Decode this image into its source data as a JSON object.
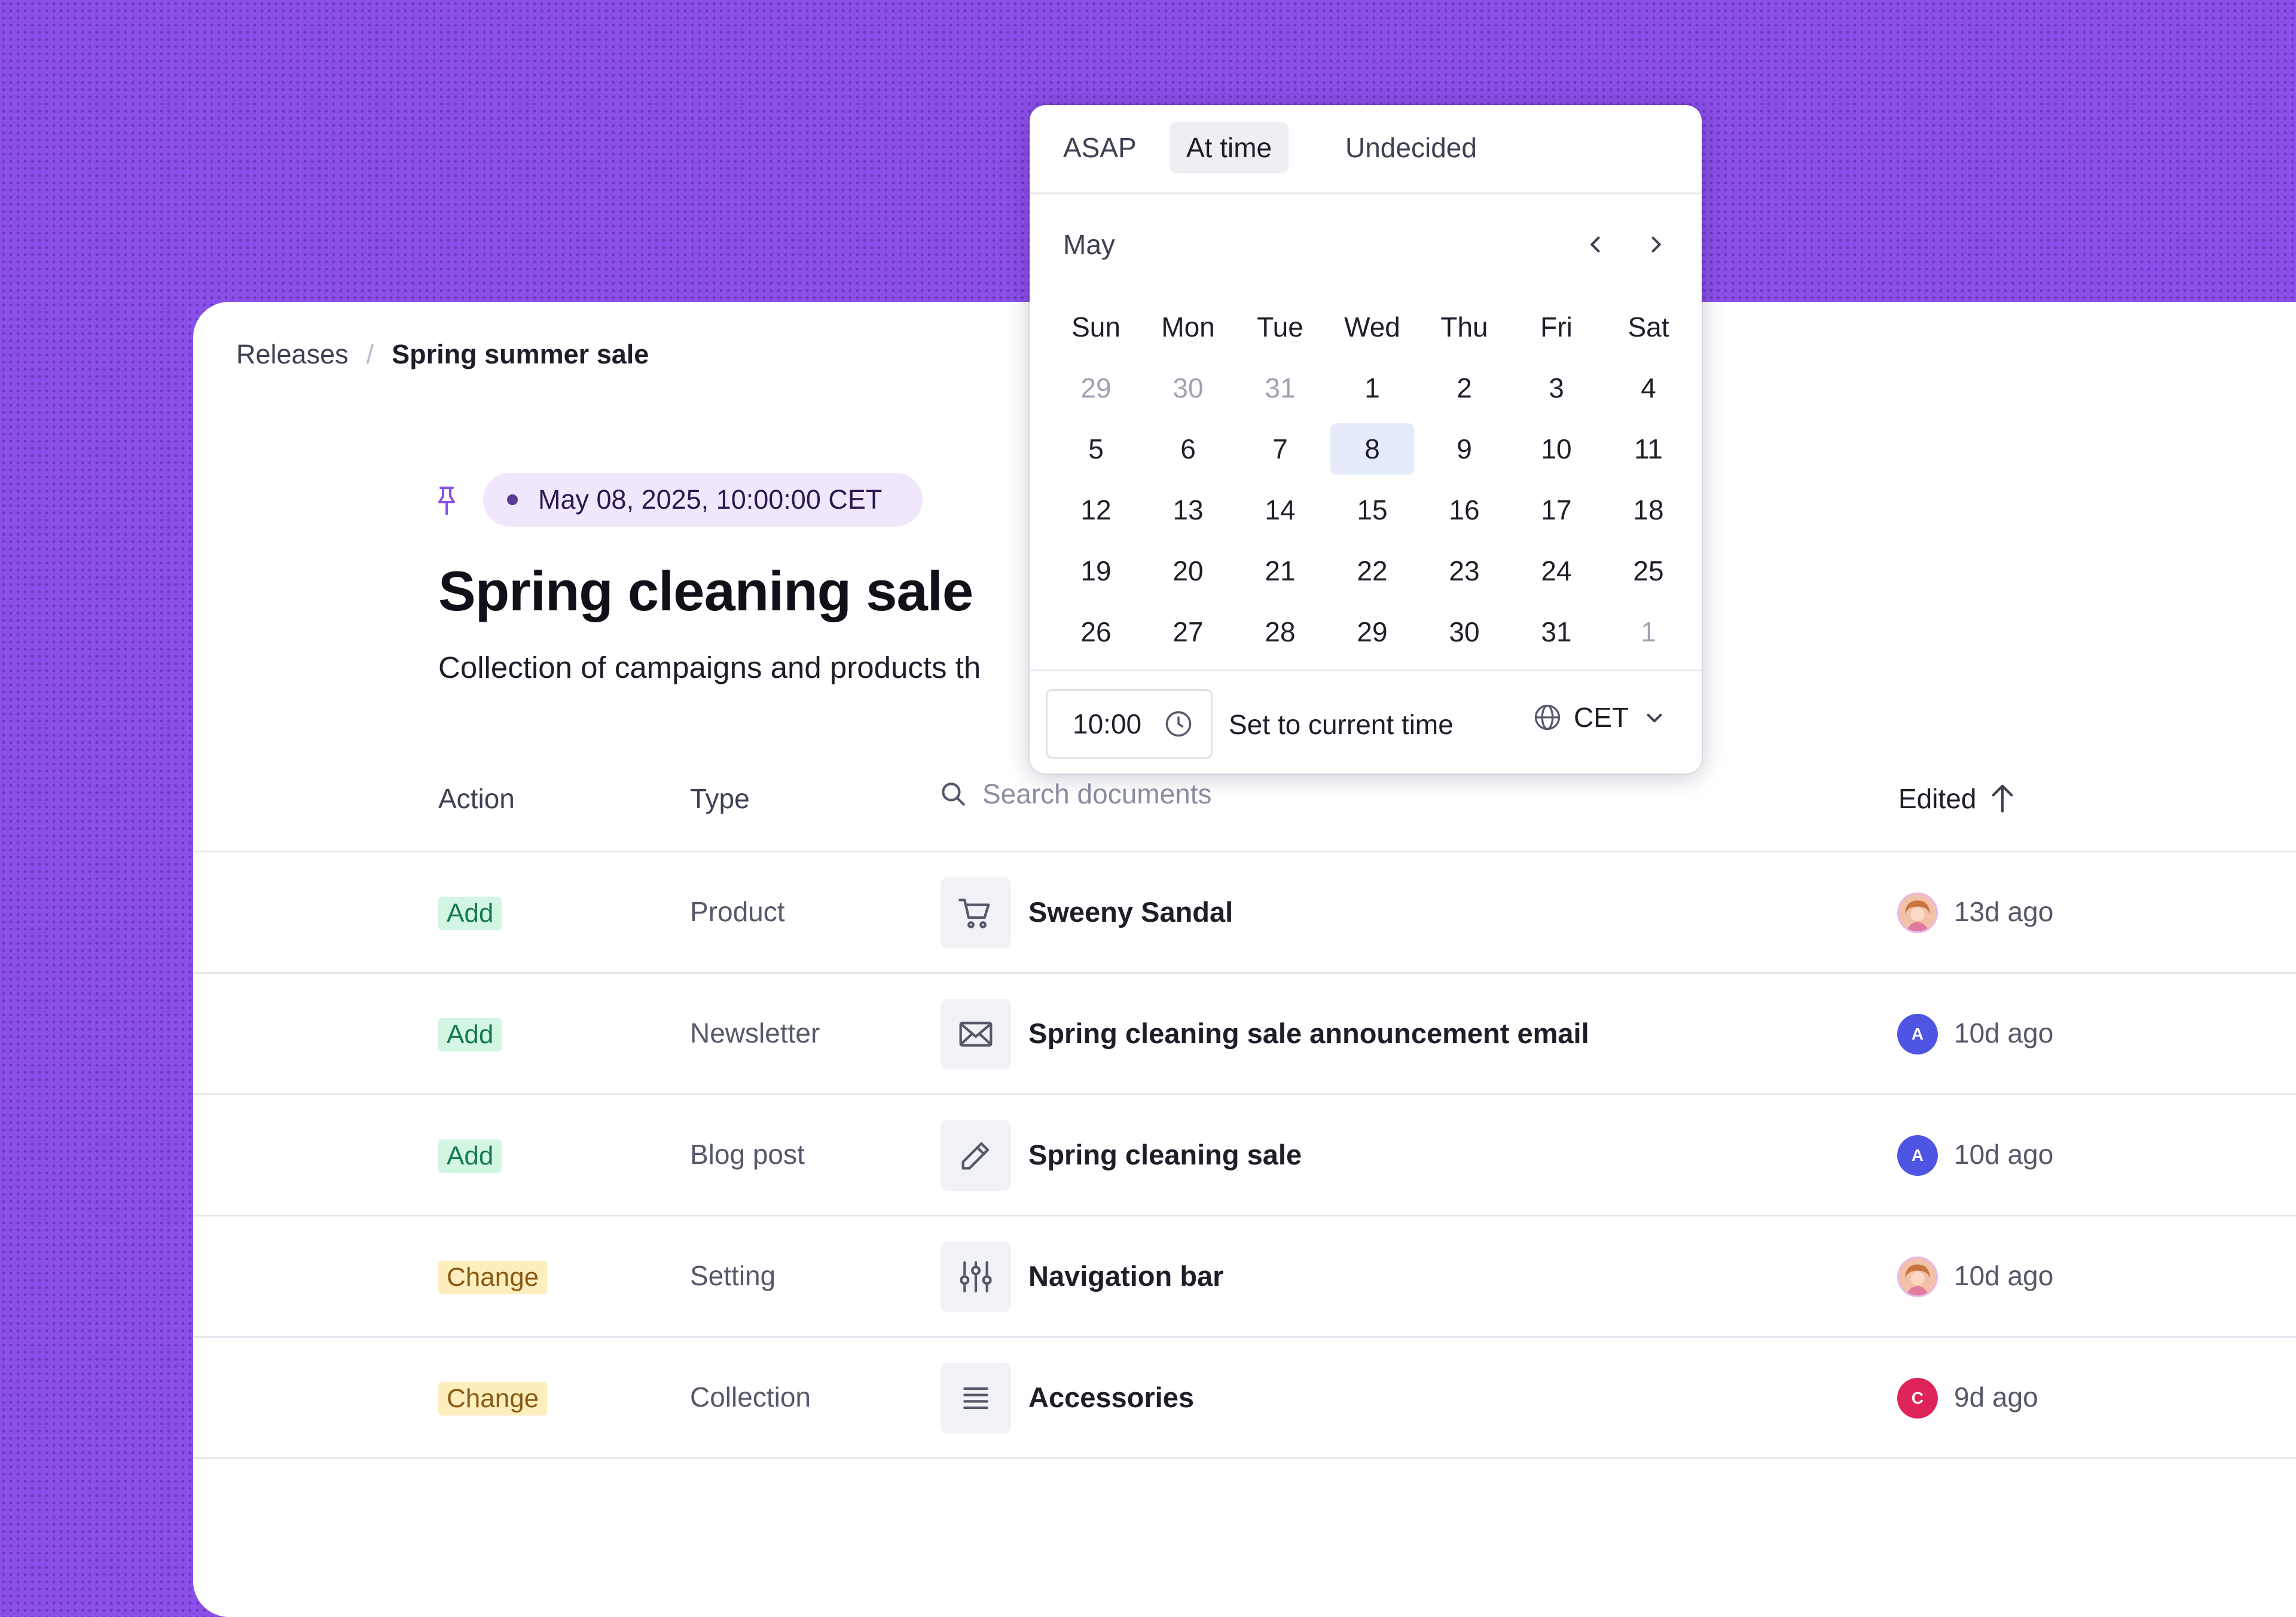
{
  "breadcrumb": {
    "root": "Releases",
    "separator": "/",
    "current": "Spring summer sale"
  },
  "release": {
    "pin_icon": "pin-icon",
    "date": "May 08, 2025, 10:00:00 CET",
    "title": "Spring cleaning sale",
    "description": "Collection of campaigns and products th"
  },
  "table": {
    "headers": {
      "action": "Action",
      "type": "Type",
      "edited": "Edited"
    },
    "search_placeholder": "Search documents",
    "rows": [
      {
        "action": "Add",
        "type": "Product",
        "icon": "cart-icon",
        "title": "Sweeny Sandal",
        "avatar": "photo",
        "edited": "13d ago"
      },
      {
        "action": "Add",
        "type": "Newsletter",
        "icon": "envelope-icon",
        "title": "Spring cleaning sale announcement email",
        "avatar": "A",
        "edited": "10d ago"
      },
      {
        "action": "Add",
        "type": "Blog post",
        "icon": "pencil-icon",
        "title": "Spring cleaning sale",
        "avatar": "A",
        "edited": "10d ago"
      },
      {
        "action": "Change",
        "type": "Setting",
        "icon": "sliders-icon",
        "title": "Navigation bar",
        "avatar": "photo",
        "edited": "10d ago"
      },
      {
        "action": "Change",
        "type": "Collection",
        "icon": "list-icon",
        "title": "Accessories",
        "avatar": "C",
        "edited": "9d ago"
      }
    ]
  },
  "scheduler": {
    "tabs": [
      "ASAP",
      "At time",
      "Undecided"
    ],
    "active_tab": "At time",
    "month": "May",
    "weekdays": [
      "Sun",
      "Mon",
      "Tue",
      "Wed",
      "Thu",
      "Fri",
      "Sat"
    ],
    "weeks": [
      [
        "29",
        "30",
        "31",
        "1",
        "2",
        "3",
        "4"
      ],
      [
        "5",
        "6",
        "7",
        "8",
        "9",
        "10",
        "11"
      ],
      [
        "12",
        "13",
        "14",
        "15",
        "16",
        "17",
        "18"
      ],
      [
        "19",
        "20",
        "21",
        "22",
        "23",
        "24",
        "25"
      ],
      [
        "26",
        "27",
        "28",
        "29",
        "30",
        "31",
        "1"
      ]
    ],
    "selected_day": "8",
    "time_value": "10:00",
    "set_current_label": "Set to current time",
    "timezone": "CET"
  },
  "colors": {
    "background": "#8a4fe8",
    "add_badge": "#d2f6e3",
    "change_badge": "#fcefbd",
    "selected_day": "#e6ebfc",
    "avatar_a": "#4f55e3",
    "avatar_c": "#df2459"
  }
}
